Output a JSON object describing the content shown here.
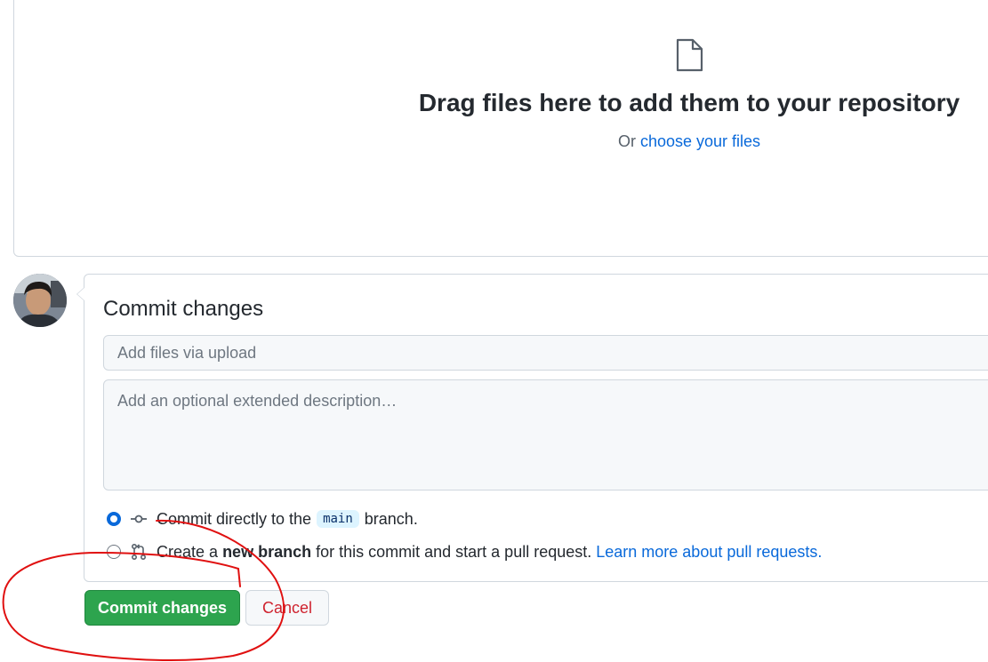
{
  "dropzone": {
    "icon": "file-icon",
    "title": "Drag files here to add them to your repository",
    "prefix": "Or",
    "choose_link": "choose your files"
  },
  "commit": {
    "title": "Commit changes",
    "summary_placeholder": "Add files via upload",
    "description_placeholder": "Add an optional extended description…",
    "option_direct": {
      "icon": "git-commit-icon",
      "before": "Commit directly to the",
      "branch": "main",
      "after": "branch."
    },
    "option_new_branch": {
      "icon": "git-pull-request-icon",
      "before": "Create a",
      "bold": "new branch",
      "after": "for this commit and start a pull request.",
      "link": "Learn more about pull requests."
    },
    "submit_label": "Commit changes",
    "cancel_label": "Cancel"
  },
  "colors": {
    "accent": "#0969da",
    "primary_button": "#2da44e",
    "danger_text": "#cf222e",
    "annotation_red": "#e01010"
  }
}
